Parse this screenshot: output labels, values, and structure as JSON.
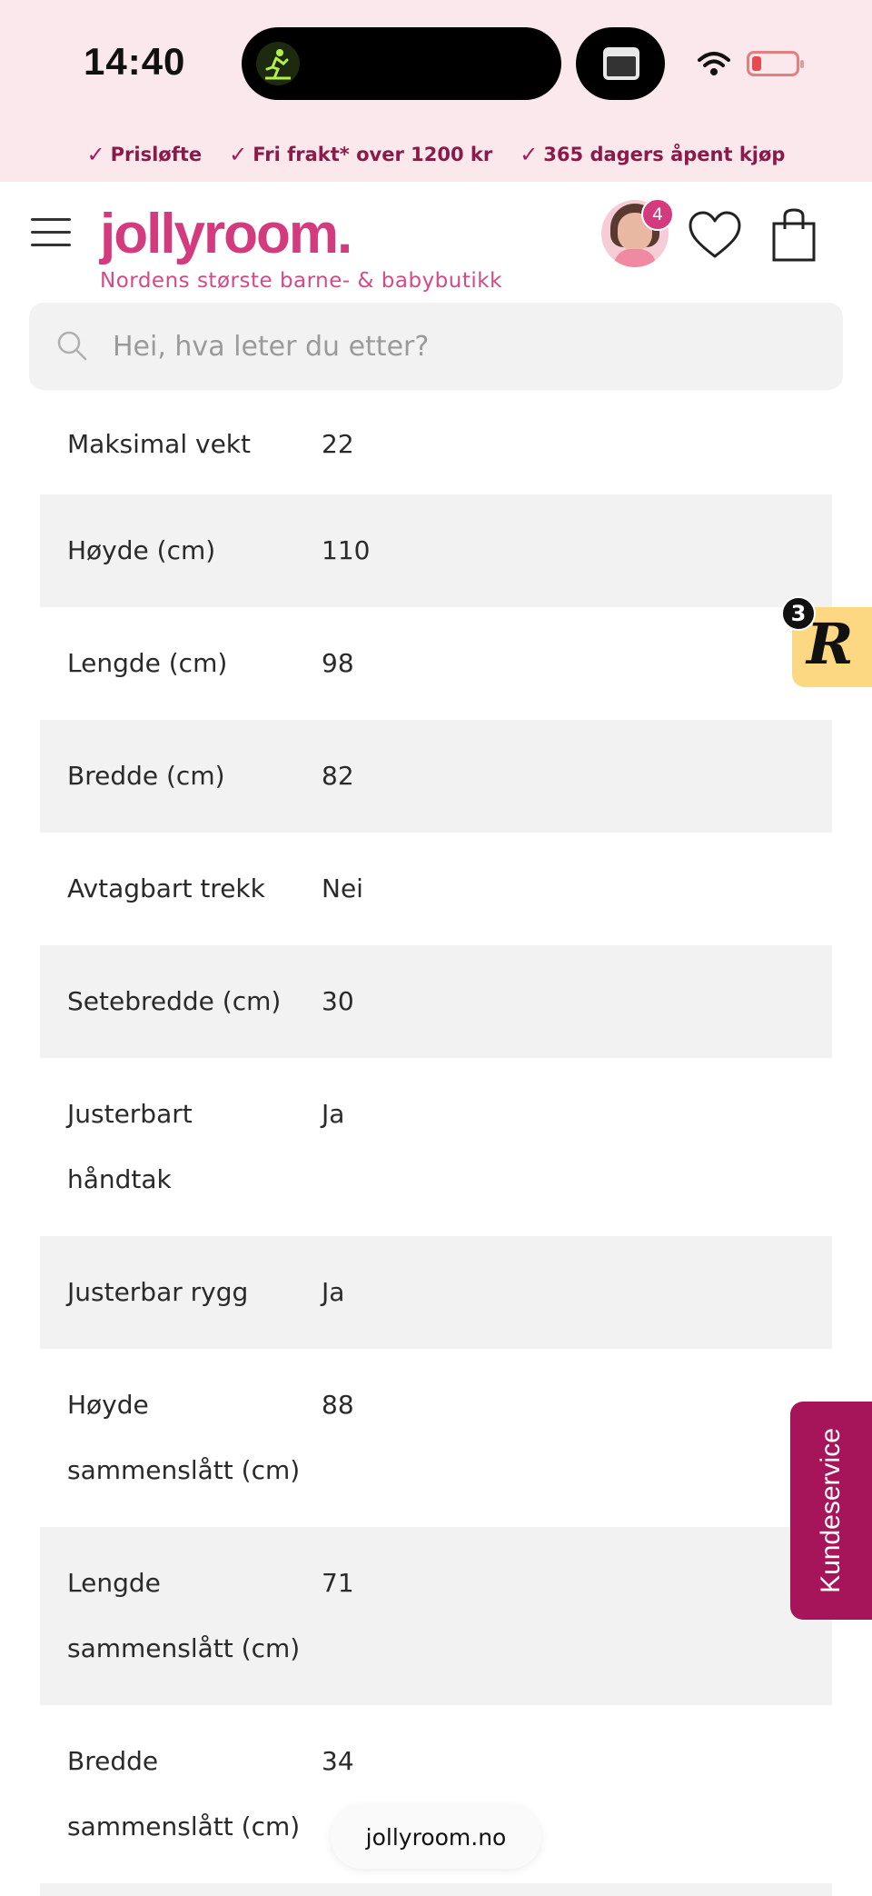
{
  "status_bar": {
    "time": "14:40"
  },
  "usp": {
    "items": [
      "Prisløfte",
      "Fri frakt* over 1200 kr",
      "365 dagers åpent kjøp"
    ]
  },
  "header": {
    "logo": "jollyroom.",
    "tagline": "Nordens største barne- & babybutikk",
    "notification_count": "4"
  },
  "search": {
    "placeholder": "Hei, hva leter du etter?"
  },
  "specs": {
    "rows": [
      {
        "label": "Maksimal vekt",
        "value": "22"
      },
      {
        "label": "Høyde (cm)",
        "value": "110"
      },
      {
        "label": "Lengde (cm)",
        "value": "98"
      },
      {
        "label": "Bredde (cm)",
        "value": "82"
      },
      {
        "label": "Avtagbart trekk",
        "value": "Nei"
      },
      {
        "label": "Setebredde (cm)",
        "value": "30"
      },
      {
        "label_line1": "Justerbart",
        "label_line2": "håndtak",
        "value": "Ja"
      },
      {
        "label": "Justerbar rygg",
        "value": "Ja"
      },
      {
        "label_line1": "Høyde",
        "label_line2": "sammenslått (cm)",
        "value": "88"
      },
      {
        "label_line1": "Lengde",
        "label_line2": "sammenslått (cm)",
        "value": "71"
      },
      {
        "label_line1": "Bredde",
        "label_line2": "sammenslått (cm)",
        "value": "34"
      }
    ]
  },
  "widgets": {
    "reviews_badge_letter": "R",
    "reviews_badge_count": "3",
    "customer_service_label": "Kundeservice"
  },
  "browser": {
    "url": "jollyroom.no"
  },
  "colors": {
    "brand_pink": "#d43a7e",
    "usp_text": "#8a1a4a",
    "header_bg": "#fbe8ec",
    "kundeservice_bg": "#a6155a",
    "badge_yellow": "#fcd882"
  }
}
